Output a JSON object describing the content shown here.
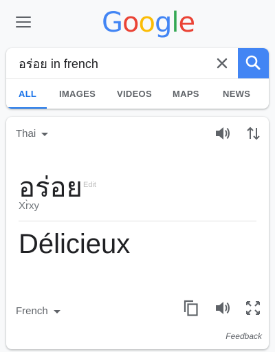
{
  "logo": {
    "letters": [
      {
        "char": "G",
        "color": "#4285f4"
      },
      {
        "char": "o",
        "color": "#ea4335"
      },
      {
        "char": "o",
        "color": "#fbbc05"
      },
      {
        "char": "g",
        "color": "#4285f4"
      },
      {
        "char": "l",
        "color": "#34a853"
      },
      {
        "char": "e",
        "color": "#ea4335"
      }
    ]
  },
  "search": {
    "query": "อร่อย in french",
    "clear_icon": "close-icon",
    "search_icon": "search-icon"
  },
  "tabs": [
    {
      "label": "ALL",
      "active": true
    },
    {
      "label": "IMAGES",
      "active": false
    },
    {
      "label": "VIDEOS",
      "active": false
    },
    {
      "label": "MAPS",
      "active": false
    },
    {
      "label": "NEWS",
      "active": false
    }
  ],
  "translate": {
    "source_lang": "Thai",
    "source_text": "อร่อย",
    "edit_label": "Edit",
    "transliteration": "Xr̀xy",
    "target_lang": "French",
    "target_text": "Délicieux",
    "feedback_label": "Feedback",
    "icons": [
      "speaker-icon",
      "swap-icon",
      "copy-icon",
      "fullscreen-icon"
    ]
  },
  "colors": {
    "accent": "#1a73e8",
    "search_button": "#4285f4",
    "icon_gray": "#5f6368"
  }
}
